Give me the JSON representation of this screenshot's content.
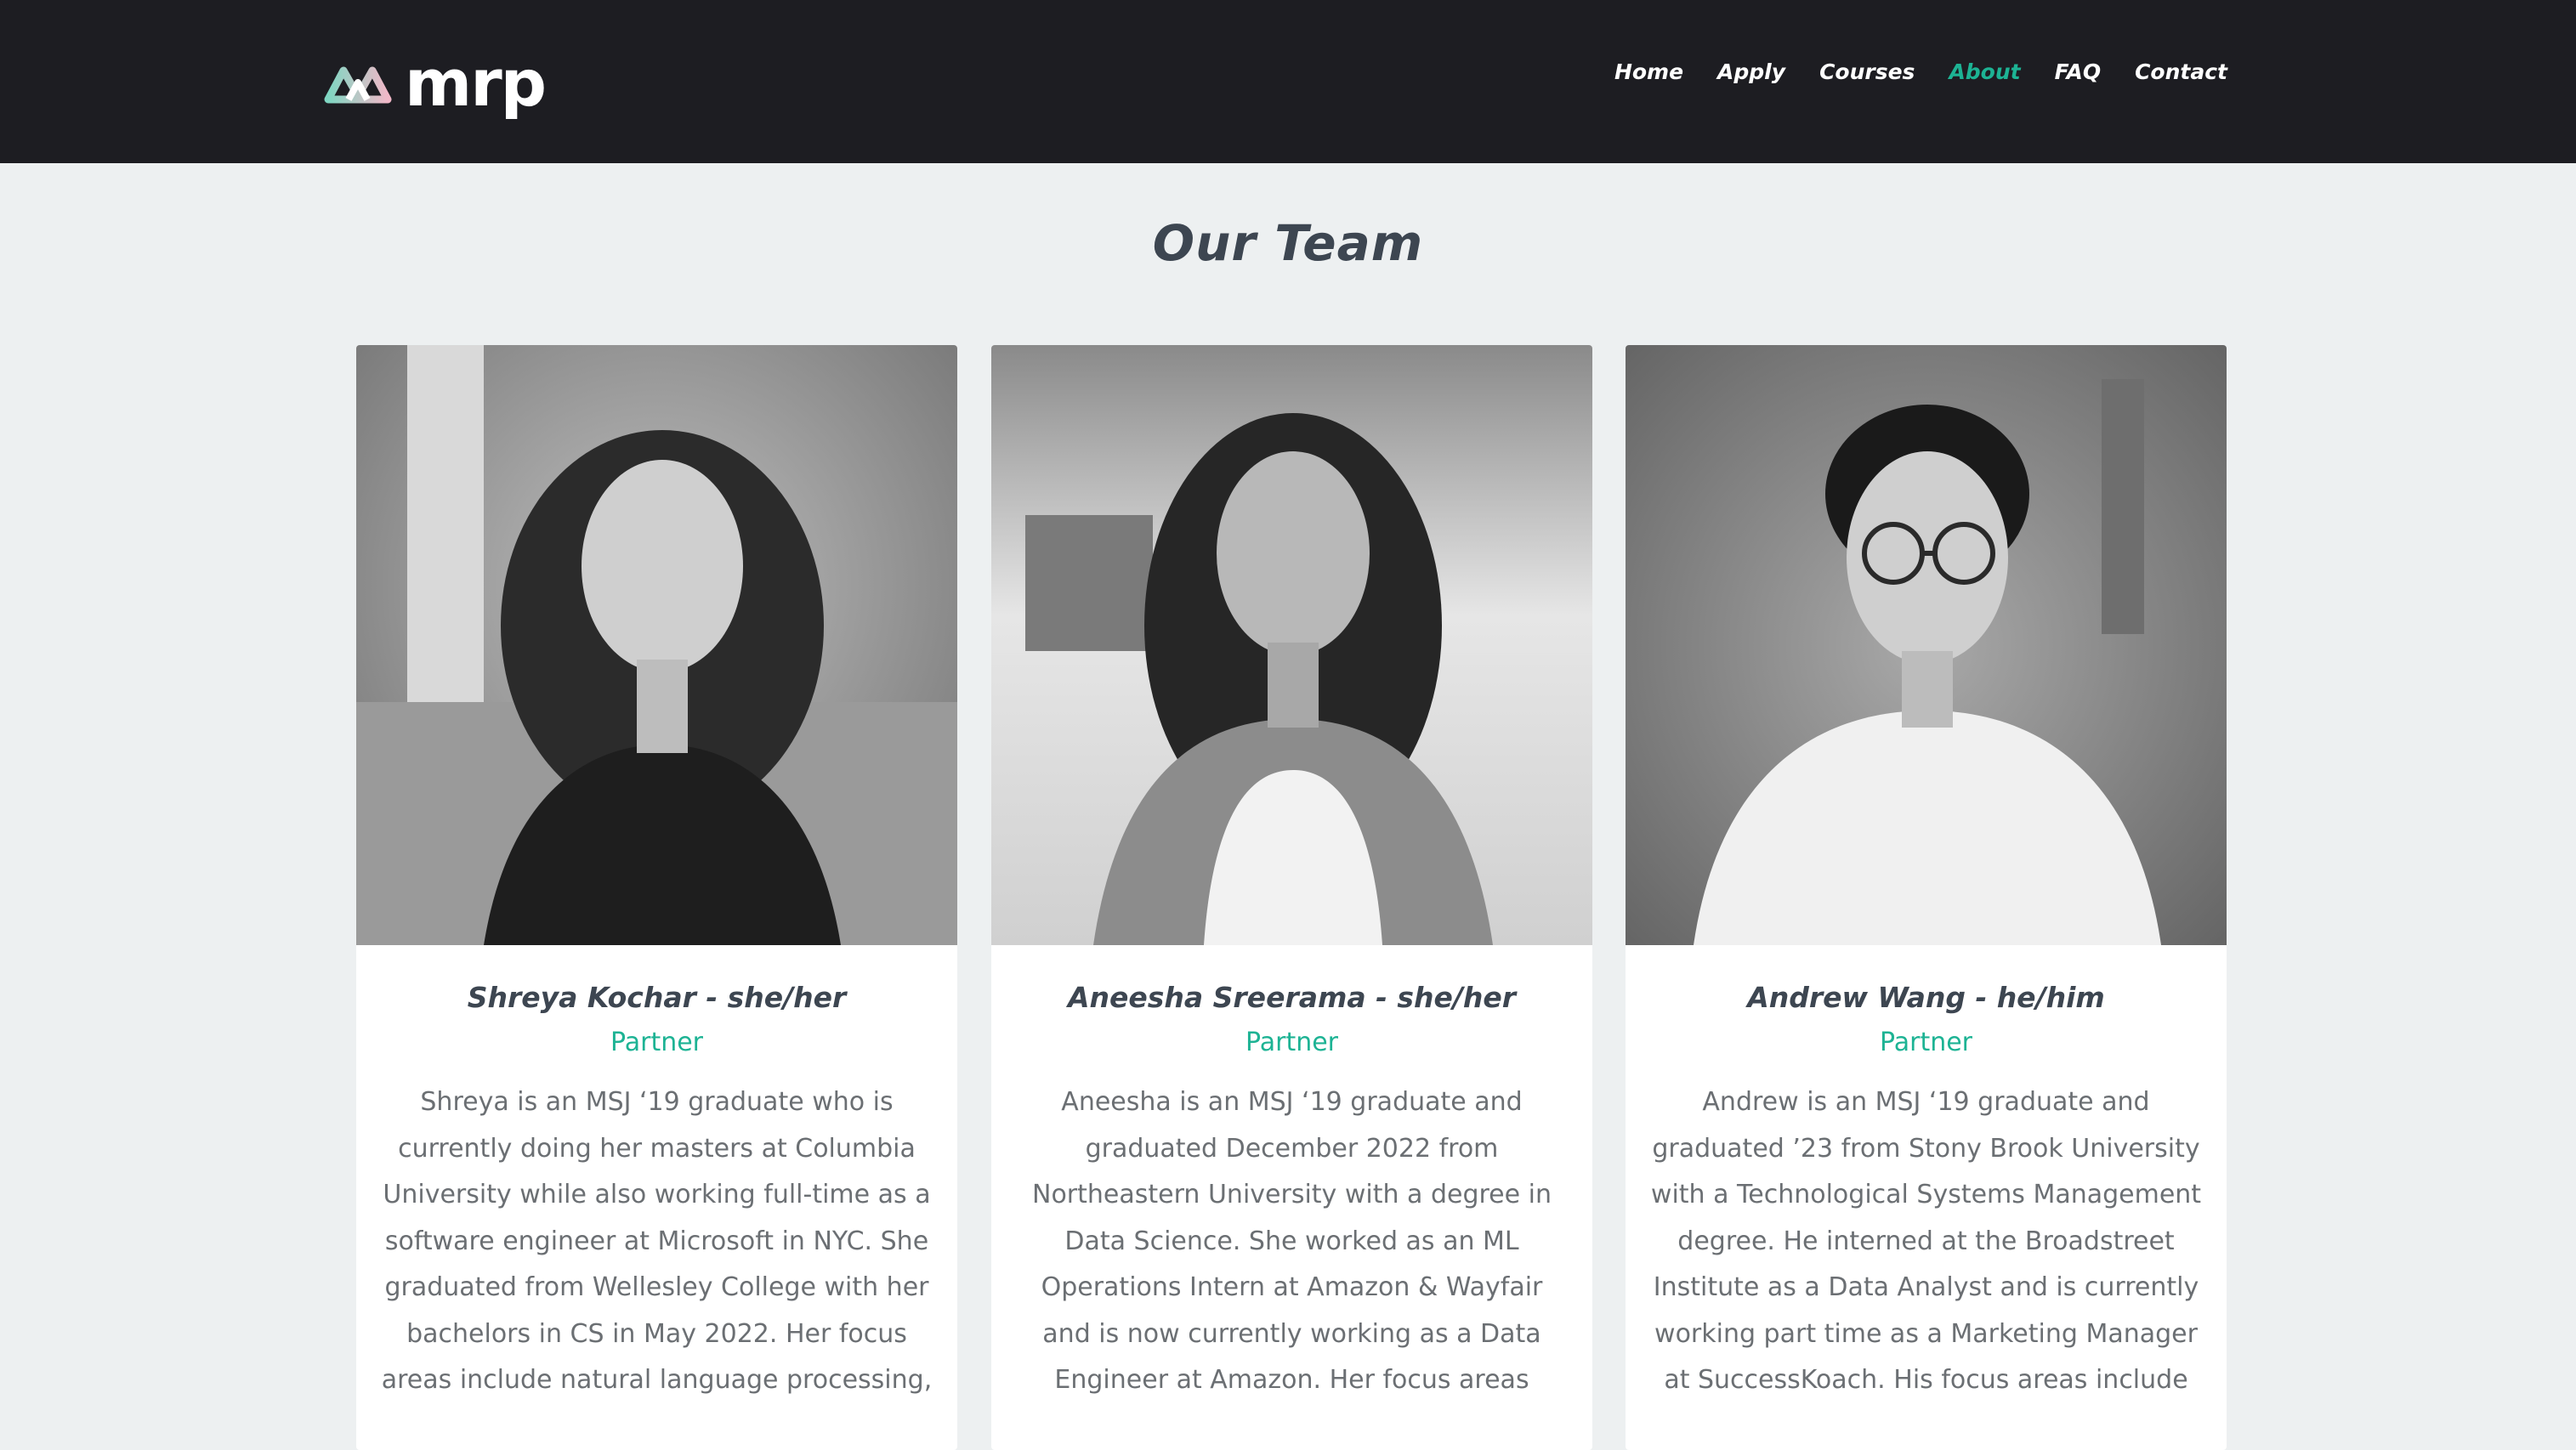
{
  "brand": {
    "logo_text": "mrp",
    "colors": {
      "nav_bg": "#1d1d22",
      "accent": "#1db394",
      "page_bg": "#edf0f1"
    }
  },
  "nav": {
    "items": [
      {
        "label": "Home",
        "active": false
      },
      {
        "label": "Apply",
        "active": false
      },
      {
        "label": "Courses",
        "active": false
      },
      {
        "label": "About",
        "active": true
      },
      {
        "label": "FAQ",
        "active": false
      },
      {
        "label": "Contact",
        "active": false
      }
    ]
  },
  "team": {
    "title": "Our Team",
    "members": [
      {
        "name": "Shreya Kochar - she/her",
        "role": "Partner",
        "bio": "Shreya is an MSJ ‘19 graduate who is currently doing her masters at Columbia University while also working full-time as a software engineer at Microsoft in NYC. She graduated from Wellesley College with her bachelors in CS in May 2022. Her focus areas include natural language processing,"
      },
      {
        "name": "Aneesha Sreerama - she/her",
        "role": "Partner",
        "bio": "Aneesha is an MSJ ‘19 graduate and graduated December 2022 from Northeastern University with a degree in Data Science. She worked as an ML Operations Intern at Amazon & Wayfair and is now currently working as a Data Engineer at Amazon. Her focus areas"
      },
      {
        "name": "Andrew Wang - he/him",
        "role": "Partner",
        "bio": "Andrew is an MSJ ‘19 graduate and graduated ’23 from Stony Brook University with a Technological Systems Management degree. He interned at the Broadstreet Institute as a Data Analyst and is currently working part time as a Marketing Manager at SuccessKoach. His focus areas include"
      }
    ]
  }
}
